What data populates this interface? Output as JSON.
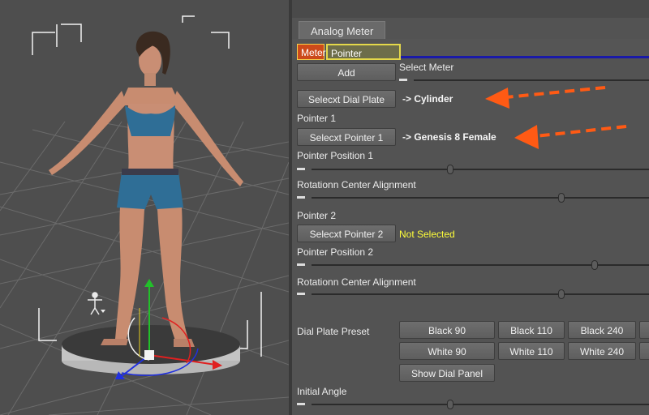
{
  "panel": {
    "tab_label": "Analog Meter",
    "subtabs": {
      "meter": "Meter",
      "pointer_position": "Pointer Position"
    },
    "add_button": "Add",
    "select_meter_label": "Select Meter",
    "dial_plate_button": "Selecxt Dial Plate",
    "dial_plate_value": "-> Cylinder",
    "pointer1_heading": "Pointer 1",
    "pointer1_button": "Selecxt Pointer 1",
    "pointer1_value": "-> Genesis 8 Female",
    "pointer_position_1_label": "Pointer Position 1",
    "rotation_center_1_label": "Rotationn Center Alignment",
    "pointer2_heading": "Pointer 2",
    "pointer2_button": "Selecxt Pointer 2",
    "pointer2_value": "Not Selected",
    "pointer_position_2_label": "Pointer Position 2",
    "rotation_center_2_label": "Rotationn Center Alignment",
    "dial_plate_preset_label": "Dial Plate Preset",
    "preset_buttons": {
      "black_90": "Black 90",
      "black_110": "Black 110",
      "black_240": "Black 240",
      "white_90": "White 90",
      "white_110": "White 110",
      "white_240": "White 240"
    },
    "show_dial_panel_button": "Show Dial Panel",
    "initial_angle_label": "Initial Angle",
    "slider_levels": {
      "select_meter": 0.0,
      "pointer_position_1": 0.41,
      "rotation_center_1": 0.74,
      "pointer_position_2": 0.84,
      "rotation_center_2": 0.74,
      "initial_angle": 0.41
    }
  },
  "colors": {
    "meter_tab": "#cc4a1a",
    "pointer_tab_border": "#e4d84a",
    "accent_blue": "#1a1aa8",
    "not_selected": "#ffff3a",
    "annotation_arrow": "#ff5a14"
  },
  "icons": [
    "figure-pose-icon",
    "transform-gizmo-icon"
  ]
}
